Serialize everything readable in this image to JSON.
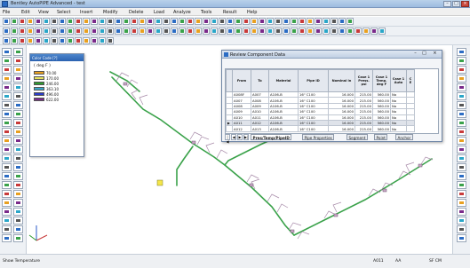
{
  "window": {
    "title": "Bentley AutoPIPE Advanced - test"
  },
  "menubar": {
    "items": [
      "File",
      "Edit",
      "View",
      "Select",
      "Insert",
      "Modify",
      "Delete",
      "Load",
      "Analyze",
      "Tools",
      "Result",
      "Help"
    ]
  },
  "legend": {
    "title": "Color Code [?]",
    "units": "( deg F )",
    "rows": [
      {
        "value": "70.00",
        "color": "#e8a020"
      },
      {
        "value": "170.00",
        "color": "#e4e060"
      },
      {
        "value": "246.00",
        "color": "#2e9a2e"
      },
      {
        "value": "363.10",
        "color": "#3aa6c8"
      },
      {
        "value": "496.00",
        "color": "#2a3cc8"
      },
      {
        "value": "622.00",
        "color": "#7a2a8a"
      }
    ]
  },
  "dialog": {
    "title": "Review Component Data",
    "columns": [
      "From",
      "To",
      "Material",
      "Pipe ID",
      "Nominal in",
      "Case 1 Press. psi",
      "Case 1 Temp. deg F",
      "Case 1 Auto",
      "C E"
    ],
    "rows": [
      {
        "from": "A008F",
        "to": "A007",
        "material": "A106-B",
        "pipe_id": "16\" C100",
        "nominal": "16.000",
        "press": "215.00",
        "temp": "560.00",
        "auto": "No",
        "ce": ""
      },
      {
        "from": "A007",
        "to": "A008",
        "material": "A106-B",
        "pipe_id": "16\" C100",
        "nominal": "16.000",
        "press": "215.00",
        "temp": "560.00",
        "auto": "No",
        "ce": ""
      },
      {
        "from": "A008",
        "to": "A009",
        "material": "A106-B",
        "pipe_id": "16\" C100",
        "nominal": "16.000",
        "press": "215.00",
        "temp": "560.00",
        "auto": "No",
        "ce": ""
      },
      {
        "from": "A009",
        "to": "A010",
        "material": "A106-B",
        "pipe_id": "16\" C100",
        "nominal": "16.000",
        "press": "215.00",
        "temp": "560.00",
        "auto": "No",
        "ce": ""
      },
      {
        "from": "A010",
        "to": "A011",
        "material": "A106-B",
        "pipe_id": "16\" C100",
        "nominal": "16.000",
        "press": "215.00",
        "temp": "560.00",
        "auto": "No",
        "ce": ""
      },
      {
        "from": "A011",
        "to": "A012",
        "material": "A106-B",
        "pipe_id": "16\" C100",
        "nominal": "16.000",
        "press": "215.00",
        "temp": "560.00",
        "auto": "No",
        "ce": ""
      },
      {
        "from": "A012",
        "to": "A013",
        "material": "A106-B",
        "pipe_id": "16\" C100",
        "nominal": "16.000",
        "press": "215.00",
        "temp": "560.00",
        "auto": "No",
        "ce": ""
      }
    ],
    "tabs": [
      "Pres/Temp/PipeID",
      "Pipe Properties",
      "Segment",
      "Point",
      "Anchor"
    ]
  },
  "status": {
    "left": "Show Temperature",
    "mid1": "A011",
    "mid2": "AA",
    "right": "SF CM"
  }
}
